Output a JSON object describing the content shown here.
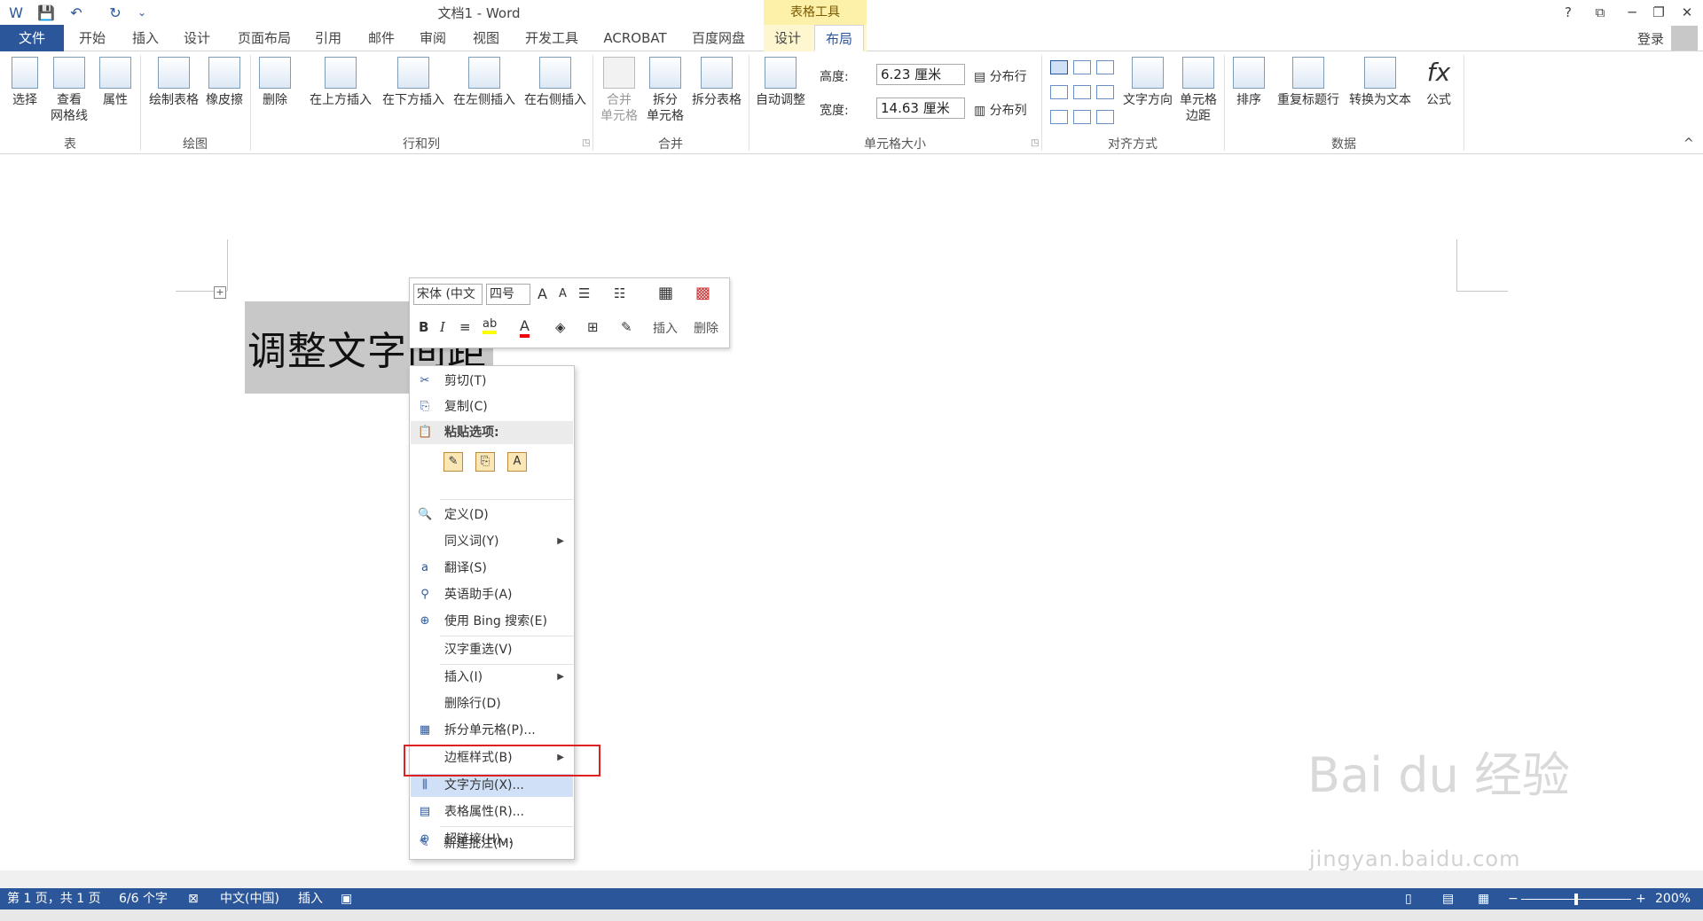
{
  "titlebar": {
    "title": "文档1 - Word",
    "context_header": "表格工具",
    "help": "?",
    "ribbon_display": "⧉",
    "minimize": "─",
    "restore": "❐",
    "close": "✕",
    "qat_word": "W",
    "qat_save": "💾",
    "qat_undo": "↶",
    "qat_redo": "↻",
    "qat_more": "⌄"
  },
  "tabs": {
    "file": "文件",
    "home": "开始",
    "insert": "插入",
    "design": "设计",
    "page_layout": "页面布局",
    "references": "引用",
    "mailings": "邮件",
    "review": "审阅",
    "view": "视图",
    "developer": "开发工具",
    "acrobat": "ACROBAT",
    "baidu": "百度网盘",
    "table_design": "设计",
    "table_layout": "布局",
    "login": "登录"
  },
  "ribbon": {
    "groups": {
      "table": "表",
      "draw": "绘图",
      "rows_cols": "行和列",
      "merge": "合并",
      "cell_size": "单元格大小",
      "alignment": "对齐方式",
      "data": "数据"
    },
    "select": "选择",
    "view_gridlines_1": "查看",
    "view_gridlines_2": "网格线",
    "properties": "属性",
    "draw_table": "绘制表格",
    "eraser": "橡皮擦",
    "delete": "删除",
    "insert_above": "在上方插入",
    "insert_below": "在下方插入",
    "insert_left": "在左侧插入",
    "insert_right": "在右侧插入",
    "merge_cells_1": "合并",
    "merge_cells_2": "单元格",
    "split_cells_1": "拆分",
    "split_cells_2": "单元格",
    "split_table": "拆分表格",
    "autofit": "自动调整",
    "height_label": "高度:",
    "height_value": "6.23 厘米",
    "width_label": "宽度:",
    "width_value": "14.63 厘米",
    "distribute_rows": "分布行",
    "distribute_cols": "分布列",
    "text_direction": "文字方向",
    "cell_margins_1": "单元格",
    "cell_margins_2": "边距",
    "sort": "排序",
    "repeat_header": "重复标题行",
    "convert_text": "转换为文本",
    "formula": "公式",
    "collapse": "^"
  },
  "document": {
    "cell_text": "调整文字间距",
    "table_move_handle": "+"
  },
  "mini_toolbar": {
    "font": "宋体 (中文",
    "size": "四号",
    "grow": "A",
    "shrink": "A",
    "bold": "B",
    "italic": "I",
    "center": "≡",
    "highlight": "ab",
    "font_color": "A",
    "insert_label": "插入",
    "delete_label": "删除"
  },
  "context_menu": {
    "items": [
      {
        "label": "剪切(T)",
        "icon": "✂"
      },
      {
        "label": "复制(C)",
        "icon": "⎘"
      },
      {
        "label": "粘贴选项:",
        "icon": "📋"
      },
      {
        "label": "定义(D)",
        "icon": "🔍"
      },
      {
        "label": "同义词(Y)",
        "icon": ""
      },
      {
        "label": "翻译(S)",
        "icon": "a"
      },
      {
        "label": "英语助手(A)",
        "icon": "⚲"
      },
      {
        "label": "使用 Bing 搜索(E)",
        "icon": "⊕"
      },
      {
        "label": "汉字重选(V)",
        "icon": ""
      },
      {
        "label": "插入(I)",
        "icon": ""
      },
      {
        "label": "删除行(D)",
        "icon": ""
      },
      {
        "label": "拆分单元格(P)...",
        "icon": "▦"
      },
      {
        "label": "边框样式(B)",
        "icon": ""
      },
      {
        "label": "文字方向(X)...",
        "icon": "⫼"
      },
      {
        "label": "表格属性(R)...",
        "icon": "▤"
      },
      {
        "label": "超链接(H)...",
        "icon": "⊕"
      },
      {
        "label": "新建批注(M)",
        "icon": "✎"
      }
    ],
    "paste_icons": [
      "✎",
      "⎘",
      "A"
    ]
  },
  "watermark": {
    "main": "Bai du 经验",
    "sub": "jingyan.baidu.com"
  },
  "statusbar": {
    "page": "第 1 页，共 1 页",
    "words": "6/6 个字",
    "language": "中文(中国)",
    "mode": "插入",
    "zoom": "200%",
    "zoom_minus": "−",
    "zoom_plus": "+",
    "zoom_level_fraction": 0.5
  }
}
